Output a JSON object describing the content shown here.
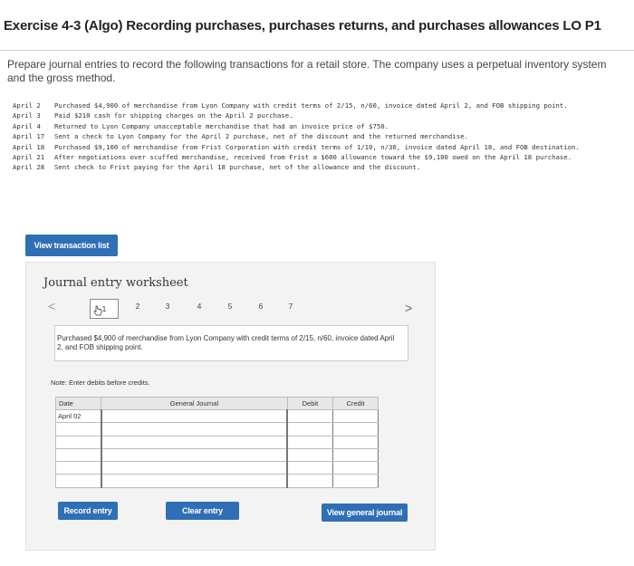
{
  "header": {
    "title": "Exercise 4-3 (Algo) Recording purchases, purchases returns, and purchases allowances LO P1"
  },
  "instructions": "Prepare journal entries to record the following transactions for a retail store. The company uses a perpetual inventory system and the gross method.",
  "transactions": [
    {
      "date": "April 2",
      "text": "Purchased $4,900 of merchandise from Lyon Company with credit terms of 2/15, n/60, invoice dated April 2, and FOB shipping point."
    },
    {
      "date": "April 3",
      "text": "Paid $210 cash for shipping charges on the April 2 purchase."
    },
    {
      "date": "April 4",
      "text": "Returned to Lyon Company unacceptable merchandise that had an invoice price of $750."
    },
    {
      "date": "April 17",
      "text": "Sent a check to Lyon Company for the April 2 purchase, net of the discount and the returned merchandise."
    },
    {
      "date": "April 18",
      "text": "Purchased $9,100 of merchandise from Frist Corporation with credit terms of 1/10, n/30, invoice dated April 18, and FOB destination."
    },
    {
      "date": "April 21",
      "text": "After negotiations over scuffed merchandise, received from Frist a $600 allowance toward the $9,100 owed on the April 18 purchase."
    },
    {
      "date": "April 28",
      "text": "Sent check to Frist paying for the April 18 purchase, net of the allowance and the discount."
    }
  ],
  "buttons": {
    "view_transaction_list": "View transaction list",
    "record_entry": "Record entry",
    "clear_entry": "Clear entry",
    "view_general_journal": "View general journal"
  },
  "worksheet": {
    "title": "Journal entry worksheet",
    "nav": {
      "prev": "<",
      "next": ">",
      "pages": [
        "1",
        "2",
        "3",
        "4",
        "5",
        "6",
        "7"
      ],
      "active_page": 1
    },
    "description": "Purchased $4,900 of merchandise from Lyon Company with credit terms of 2/15, n/60, invoice dated April 2, and FOB shipping point.",
    "note": "Note: Enter debits before credits.",
    "table": {
      "headers": {
        "date": "Date",
        "general_journal": "General Journal",
        "debit": "Debit",
        "credit": "Credit"
      },
      "first_date": "April 02"
    }
  },
  "colors": {
    "button_blue": "#2f6fb6",
    "worksheet_bg": "#f3f3f3"
  }
}
